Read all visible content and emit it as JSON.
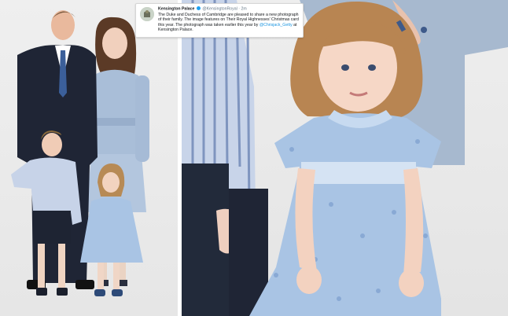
{
  "tweet": {
    "author_name": "Kensington Palace",
    "handle": "@KensingtonRoyal",
    "separator": "·",
    "time": "2m",
    "text_1": "The Duke and Duchess of Cambridge are pleased to share a new photograph of their family. The image features on Their Royal Highnesses' Christmas card this year. The photograph was taken earlier this year by ",
    "mention": "@Chrisjack_Getty",
    "text_2": " at Kensington Palace.",
    "verified_icon": "verified-badge-icon",
    "link_color": "#1b95e0"
  },
  "photos": {
    "left": "family-portrait",
    "right": "girl-closeup"
  },
  "colors": {
    "background": "#ebebeb",
    "dress_blue": "#a9c4e4",
    "suit_navy": "#1f2535"
  }
}
